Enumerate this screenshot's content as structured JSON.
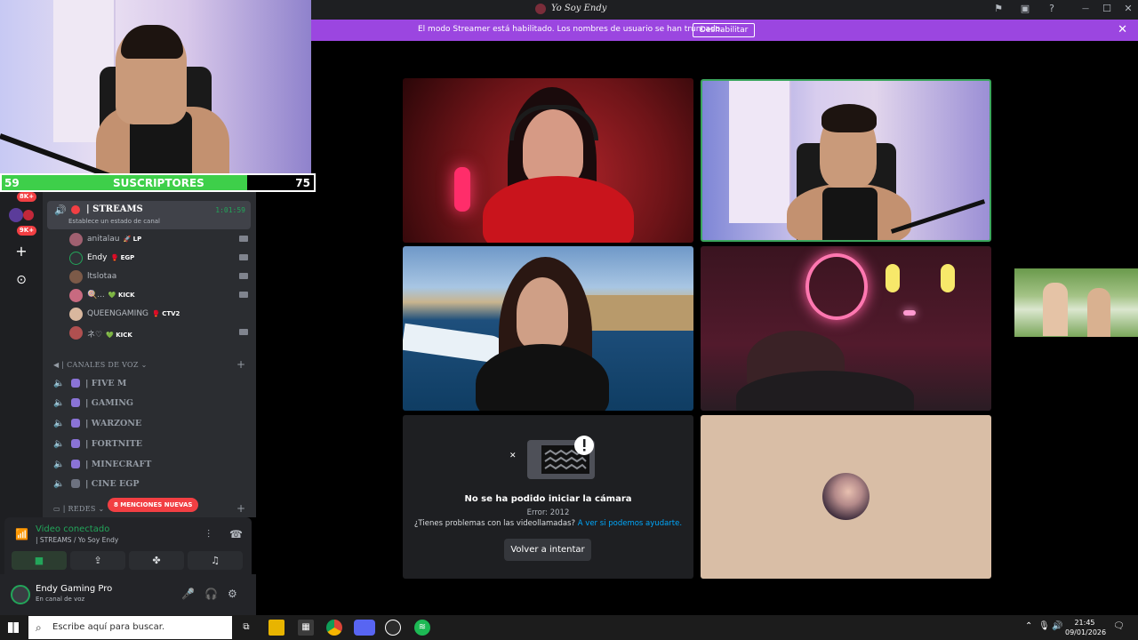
{
  "window": {
    "title": "Yo Soy Endy",
    "controls": {
      "minimize": "—",
      "maximize": "☐",
      "close": "✕"
    }
  },
  "streamer_banner": {
    "text": "El modo Streamer está habilitado. Los nombres de usuario se han truncado.",
    "button": "Deshabilitar",
    "close": "✕"
  },
  "webcam_overlay": {
    "sub_goal": {
      "current": "59",
      "label": "SUSCRIPTORES",
      "target": "75",
      "progress": 0.787
    }
  },
  "server_rail": {
    "badges": [
      "8K+",
      "9K+"
    ],
    "add_label": "+",
    "discover_label": "⊙"
  },
  "channel": {
    "name": "| STREAMS",
    "status_placeholder": "Establece un estado de canal",
    "timer": "1:01:59",
    "members": [
      {
        "name": "anitalau",
        "tag": "🚀 LP",
        "avatar_color": "#a06070",
        "camera": true
      },
      {
        "name": "Endy",
        "tag": "🥊 EGP",
        "avatar_color": "#2f3136",
        "camera": true
      },
      {
        "name": "ltslotaa",
        "tag": "",
        "avatar_color": "#7c5a48",
        "camera": true
      },
      {
        "name": "🍭...",
        "tag": "💚 KICK",
        "avatar_color": "#c86a80",
        "camera": true
      },
      {
        "name": "QUEENGAMING",
        "tag": "🥊 CTV2",
        "avatar_color": "#d9b79e",
        "camera": false
      },
      {
        "name": "ネ♡",
        "tag": "💚 KICK",
        "avatar_color": "#b05050",
        "camera": true
      }
    ]
  },
  "voice_category": {
    "label": "| CANALES DE VOZ",
    "add": "+",
    "channels": [
      "| FIVE M",
      "| GAMING",
      "| WARZONE",
      "| FORTNITE",
      "| MINECRAFT",
      "| CINE EGP"
    ]
  },
  "redes_category": {
    "label": "| REDES",
    "add": "+"
  },
  "mentions_pill": "8 MENCIONES NUEVAS",
  "voice_panel": {
    "status": "Video conectado",
    "channel": "| STREAMS / Yo Soy Endy",
    "buttons": [
      "camera",
      "screen-share",
      "activities",
      "soundboard"
    ]
  },
  "user_panel": {
    "name": "Endy Gaming Pro",
    "status": "En canal de voz"
  },
  "camera_error": {
    "title": "No se ha podido iniciar la cámara",
    "code": "Error: 2012",
    "help": "¿Tienes problemas con las videollamadas?",
    "link": "A ver si podemos ayudarte.",
    "retry": "Volver a intentar"
  },
  "taskbar": {
    "search_placeholder": "Escribe aquí para buscar.",
    "time": "21:45",
    "date": "09/01/2026"
  }
}
